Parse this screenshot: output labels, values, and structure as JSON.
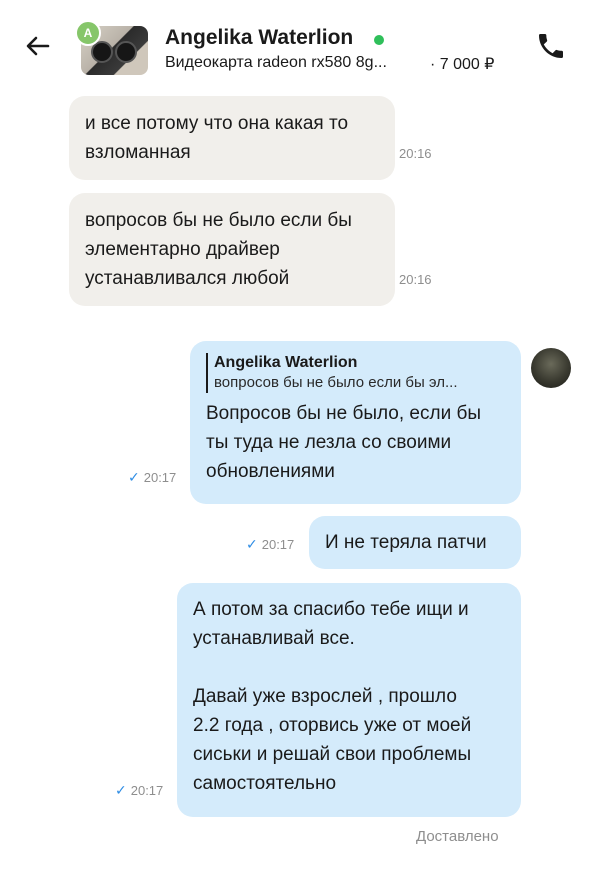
{
  "header": {
    "contact_letter": "A",
    "contact_name": "Angelika Waterlion",
    "item_title": "Видеокарта radeon rx580 8g...",
    "item_price": "· 7 000 ₽"
  },
  "messages": [
    {
      "direction": "in",
      "lines": [
        "и все потому что она какая то",
        "взломанная"
      ],
      "time": "20:16"
    },
    {
      "direction": "in",
      "lines": [
        "вопросов бы не было если бы",
        "элементарно драйвер",
        "устанавливался любой"
      ],
      "time": "20:16"
    },
    {
      "direction": "out",
      "quote_name": "Angelika Waterlion",
      "quote_text": "вопросов бы не было если бы эл...",
      "lines": [
        "Вопросов бы не было, если бы",
        "ты туда не лезла со своими",
        "обновлениями"
      ],
      "time": "20:17"
    },
    {
      "direction": "out",
      "lines": [
        "И не теряла патчи"
      ],
      "time": "20:17"
    },
    {
      "direction": "out",
      "lines": [
        "А потом за спасибо тебе ищи и",
        "устанавливай все.",
        "",
        "Давай уже взрослей , прошло",
        "2.2 года , оторвись уже от моей",
        "сиськи и решай свои проблемы",
        "самостоятельно"
      ],
      "time": "20:17"
    }
  ],
  "status_text": "Доставлено",
  "icons": {
    "back": "arrow-left-icon",
    "phone": "phone-icon",
    "check": "check-icon"
  },
  "colors": {
    "incoming_bubble": "#f1efeb",
    "outgoing_bubble": "#d4ebfb",
    "online": "#2fbf5a",
    "check": "#2f8de4"
  }
}
